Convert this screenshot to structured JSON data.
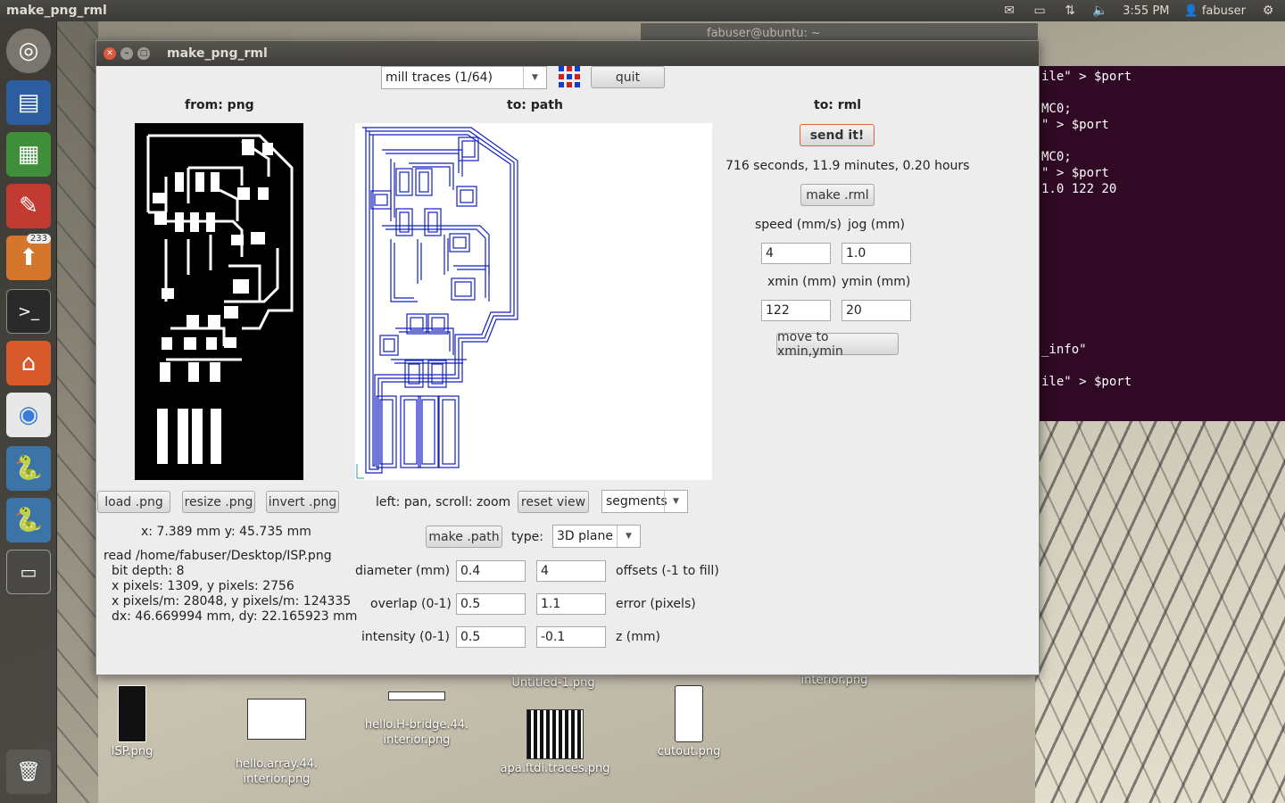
{
  "top_panel": {
    "app_title": "make_png_rml",
    "time": "3:55 PM",
    "user": "fabuser"
  },
  "launcher": {
    "badge_count": "233"
  },
  "terminal": {
    "title": "fabuser@ubuntu: ~",
    "lines": [
      "ile\" > $port",
      "",
      "MC0;",
      "\" > $port",
      "",
      "MC0;",
      "\" > $port",
      "1.0 122 20",
      "",
      "",
      "",
      "",
      "",
      "",
      "",
      "",
      "",
      "_info\"",
      "",
      "ile\" > $port"
    ]
  },
  "window": {
    "title": "make_png_rml",
    "mode_select": "mill traces (1/64)",
    "quit_label": "quit",
    "from_header": "from: png",
    "path_header": "to: path",
    "rml_header": "to: rml",
    "send_label": "send it!",
    "time_estimate": "716 seconds, 11.9 minutes, 0.20 hours",
    "make_rml_label": "make .rml",
    "speed_label": "speed (mm/s)",
    "jog_label": "jog (mm)",
    "speed_value": "4",
    "jog_value": "1.0",
    "xmin_label": "xmin (mm)",
    "ymin_label": "ymin (mm)",
    "xmin_value": "122",
    "ymin_value": "20",
    "move_label": "move to xmin,ymin",
    "load_label": "load .png",
    "resize_label": "resize .png",
    "invert_label": "invert .png",
    "coords": "x: 7.389 mm  y: 45.735 mm",
    "info": [
      "read /home/fabuser/Desktop/ISP.png",
      "bit depth: 8",
      "x pixels: 1309, y pixels: 2756",
      "x pixels/m: 28048, y pixels/m: 124335",
      "dx: 46.669994 mm, dy: 22.165923 mm"
    ],
    "pan_hint": "left: pan, scroll: zoom",
    "reset_view_label": "reset view",
    "view_select": "segments",
    "make_path_label": "make .path",
    "type_label": "type:",
    "type_select": "3D plane",
    "diameter_label": "diameter (mm)",
    "diameter_value": "0.4",
    "offsets_value": "4",
    "offsets_label": "offsets (-1 to fill)",
    "overlap_label": "overlap (0-1)",
    "overlap_value": "0.5",
    "error_value": "1.1",
    "error_label": "error (pixels)",
    "intensity_label": "intensity (0-1)",
    "intensity_value": "0.5",
    "z_value": "-0.1",
    "z_label": "z (mm)"
  },
  "desktop_icons": [
    {
      "label": "ISP.png"
    },
    {
      "label": "hello.array.44.\ninterior.png"
    },
    {
      "label": "hello.H-bridge.44.\ninterior.png"
    },
    {
      "label": "Untitled-1.png"
    },
    {
      "label": "apa.ftdi.traces.png"
    },
    {
      "label": "cutout.png"
    },
    {
      "label": "interior.png"
    }
  ]
}
